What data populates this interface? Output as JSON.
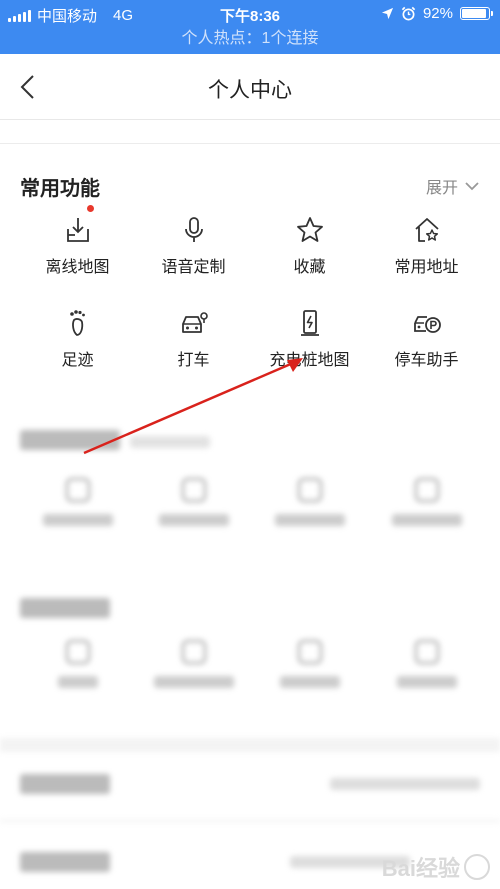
{
  "status_bar": {
    "carrier": "中国移动",
    "network": "4G",
    "time": "下午8:36",
    "battery_percent": "92%",
    "battery_level": 0.92
  },
  "hotspot_text": "个人热点：1个连接",
  "header": {
    "title": "个人中心"
  },
  "common_functions": {
    "title": "常用功能",
    "expand_label": "展开",
    "items": [
      {
        "label": "离线地图",
        "icon": "download-map-icon"
      },
      {
        "label": "语音定制",
        "icon": "microphone-icon"
      },
      {
        "label": "收藏",
        "icon": "star-icon"
      },
      {
        "label": "常用地址",
        "icon": "home-star-icon"
      },
      {
        "label": "足迹",
        "icon": "footprint-icon"
      },
      {
        "label": "打车",
        "icon": "taxi-icon"
      },
      {
        "label": "充电桩地图",
        "icon": "charging-pile-icon"
      },
      {
        "label": "停车助手",
        "icon": "parking-car-icon"
      }
    ]
  },
  "colors": {
    "status_bar_bg": "#3d8af1",
    "annotation_arrow": "#d9221c",
    "notification_dot": "#e8382c"
  },
  "watermark": "Bai经验"
}
